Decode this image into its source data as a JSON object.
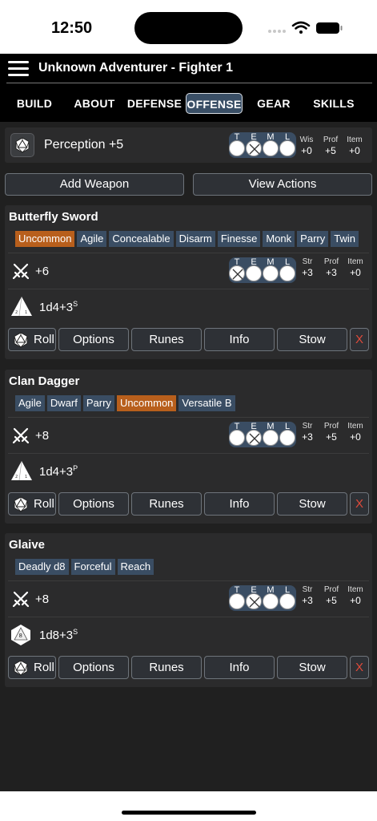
{
  "status": {
    "time": "12:50"
  },
  "header": {
    "title": "Unknown Adventurer - Fighter 1"
  },
  "tabs": [
    {
      "label": "BUILD"
    },
    {
      "label": "ABOUT"
    },
    {
      "label": "DEFENSE"
    },
    {
      "label": "OFFENSE",
      "active": true
    },
    {
      "label": "GEAR"
    },
    {
      "label": "SKILLS"
    }
  ],
  "teml_letters": [
    "T",
    "E",
    "M",
    "L"
  ],
  "perception": {
    "label": "Perception +5",
    "stats": [
      {
        "label": "Wis",
        "value": "+0"
      },
      {
        "label": "Prof",
        "value": "+5"
      },
      {
        "label": "Item",
        "value": "+0"
      }
    ]
  },
  "buttons": {
    "add_weapon": "Add Weapon",
    "view_actions": "View Actions"
  },
  "action_labels": {
    "roll": "Roll",
    "options": "Options",
    "runes": "Runes",
    "info": "Info",
    "stow": "Stow",
    "remove": "X"
  },
  "weapons": [
    {
      "name": "Butterfly Sword",
      "tags": [
        "Uncommon",
        "Agile",
        "Concealable",
        "Disarm",
        "Finesse",
        "Monk",
        "Parry",
        "Twin"
      ],
      "attack": "+6",
      "damage": "1d4+3",
      "damage_type": "S",
      "stats": [
        {
          "label": "Str",
          "value": "+3"
        },
        {
          "label": "Prof",
          "value": "+3"
        },
        {
          "label": "Item",
          "value": "+0"
        }
      ]
    },
    {
      "name": "Clan Dagger",
      "tags": [
        "Agile",
        "Dwarf",
        "Parry",
        "Uncommon",
        "Versatile B"
      ],
      "attack": "+8",
      "damage": "1d4+3",
      "damage_type": "P",
      "stats": [
        {
          "label": "Str",
          "value": "+3"
        },
        {
          "label": "Prof",
          "value": "+5"
        },
        {
          "label": "Item",
          "value": "+0"
        }
      ]
    },
    {
      "name": "Glaive",
      "tags": [
        "Deadly d8",
        "Forceful",
        "Reach"
      ],
      "attack": "+8",
      "damage": "1d8+3",
      "damage_type": "S",
      "die_label": "8",
      "stats": [
        {
          "label": "Str",
          "value": "+3"
        },
        {
          "label": "Prof",
          "value": "+5"
        },
        {
          "label": "Item",
          "value": "+0"
        }
      ]
    }
  ],
  "colors": {
    "accent": "#3a4d63",
    "uncommon": "#b85f1c",
    "remove": "#e04a3a",
    "panel": "#2b2b2c"
  },
  "icons": [
    "d20-icon",
    "crossed-swords-icon",
    "d4-icon",
    "d8-icon",
    "wifi-icon",
    "battery-icon",
    "signal-icon",
    "menu-icon"
  ]
}
